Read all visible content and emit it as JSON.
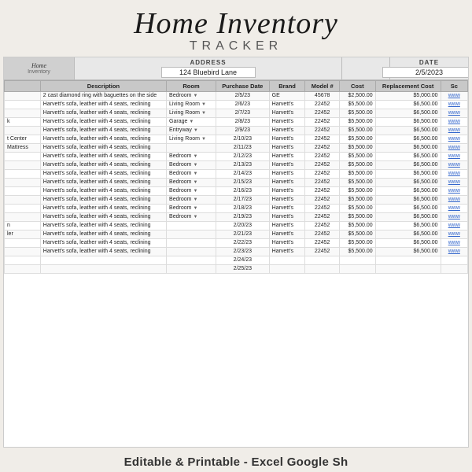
{
  "title": {
    "main": "Home Inventory",
    "sub": "Tracker"
  },
  "meta": {
    "logo_line1": "Home",
    "logo_line2": "Inventory",
    "address_label": "ADDRESS",
    "address_value": "124 Bluebird Lane",
    "date_label": "DATE",
    "date_value": "2/5/2023"
  },
  "table": {
    "headers": [
      "",
      "Description",
      "Room",
      "Purchase Date",
      "Brand",
      "Model #",
      "Cost",
      "Replacement Cost",
      "Sc"
    ],
    "rows": [
      [
        "",
        "2 cast diamond ring with baguettes on the side",
        "Bedroom",
        "2/5/23",
        "GE",
        "45678",
        "$2,500.00",
        "$5,000.00",
        "www"
      ],
      [
        "",
        "Harvett's sofa, leather with 4 seats, reclining",
        "Living Room",
        "2/6/23",
        "Harvett's",
        "22452",
        "$5,500.00",
        "$6,500.00",
        "www"
      ],
      [
        "",
        "Harvett's sofa, leather with 4 seats, reclining",
        "Living Room",
        "2/7/23",
        "Harvett's",
        "22452",
        "$5,500.00",
        "$6,500.00",
        "www"
      ],
      [
        "k",
        "Harvett's sofa, leather with 4 seats, reclining",
        "Garage",
        "2/8/23",
        "Harvett's",
        "22452",
        "$5,500.00",
        "$6,500.00",
        "www"
      ],
      [
        "",
        "Harvett's sofa, leather with 4 seats, reclining",
        "Entryway",
        "2/9/23",
        "Harvett's",
        "22452",
        "$5,500.00",
        "$6,500.00",
        "www"
      ],
      [
        "t Center",
        "Harvett's sofa, leather with 4 seats, reclining",
        "Living Room",
        "2/10/23",
        "Harvett's",
        "22452",
        "$5,500.00",
        "$6,500.00",
        "www"
      ],
      [
        "Mattress",
        "Harvett's sofa, leather with 4 seats, reclining",
        "",
        "2/11/23",
        "Harvett's",
        "22452",
        "$5,500.00",
        "$6,500.00",
        "www"
      ],
      [
        "",
        "Harvett's sofa, leather with 4 seats, reclining",
        "Bedroom",
        "2/12/23",
        "Harvett's",
        "22452",
        "$5,500.00",
        "$6,500.00",
        "www"
      ],
      [
        "",
        "Harvett's sofa, leather with 4 seats, reclining",
        "Bedroom",
        "2/13/23",
        "Harvett's",
        "22452",
        "$5,500.00",
        "$6,500.00",
        "www"
      ],
      [
        "",
        "Harvett's sofa, leather with 4 seats, reclining",
        "Bedroom",
        "2/14/23",
        "Harvett's",
        "22452",
        "$5,500.00",
        "$6,500.00",
        "www"
      ],
      [
        "",
        "Harvett's sofa, leather with 4 seats, reclining",
        "Bedroom",
        "2/15/23",
        "Harvett's",
        "22452",
        "$5,500.00",
        "$6,500.00",
        "www"
      ],
      [
        "",
        "Harvett's sofa, leather with 4 seats, reclining",
        "Bedroom",
        "2/16/23",
        "Harvett's",
        "22452",
        "$5,500.00",
        "$6,500.00",
        "www"
      ],
      [
        "",
        "Harvett's sofa, leather with 4 seats, reclining",
        "Bedroom",
        "2/17/23",
        "Harvett's",
        "22452",
        "$5,500.00",
        "$6,500.00",
        "www"
      ],
      [
        "",
        "Harvett's sofa, leather with 4 seats, reclining",
        "Bedroom",
        "2/18/23",
        "Harvett's",
        "22452",
        "$5,500.00",
        "$6,500.00",
        "www"
      ],
      [
        "",
        "Harvett's sofa, leather with 4 seats, reclining",
        "Bedroom",
        "2/19/23",
        "Harvett's",
        "22452",
        "$5,500.00",
        "$6,500.00",
        "www"
      ],
      [
        "n",
        "Harvett's sofa, leather with 4 seats, reclining",
        "",
        "2/20/23",
        "Harvett's",
        "22452",
        "$5,500.00",
        "$6,500.00",
        "www"
      ],
      [
        "ler",
        "Harvett's sofa, leather with 4 seats, reclining",
        "",
        "2/21/23",
        "Harvett's",
        "22452",
        "$5,500.00",
        "$6,500.00",
        "www"
      ],
      [
        "",
        "Harvett's sofa, leather with 4 seats, reclining",
        "",
        "2/22/23",
        "Harvett's",
        "22452",
        "$5,500.00",
        "$6,500.00",
        "www"
      ],
      [
        "",
        "Harvett's sofa, leather with 4 seats, reclining",
        "",
        "2/23/23",
        "Harvett's",
        "22452",
        "$5,500.00",
        "$6,500.00",
        "www"
      ],
      [
        "",
        "",
        "",
        "2/24/23",
        "",
        "",
        "",
        "",
        ""
      ],
      [
        "",
        "",
        "",
        "2/25/23",
        "",
        "",
        "",
        "",
        ""
      ]
    ]
  },
  "footer": {
    "text": "able & Printable - Excel Google Sh"
  }
}
